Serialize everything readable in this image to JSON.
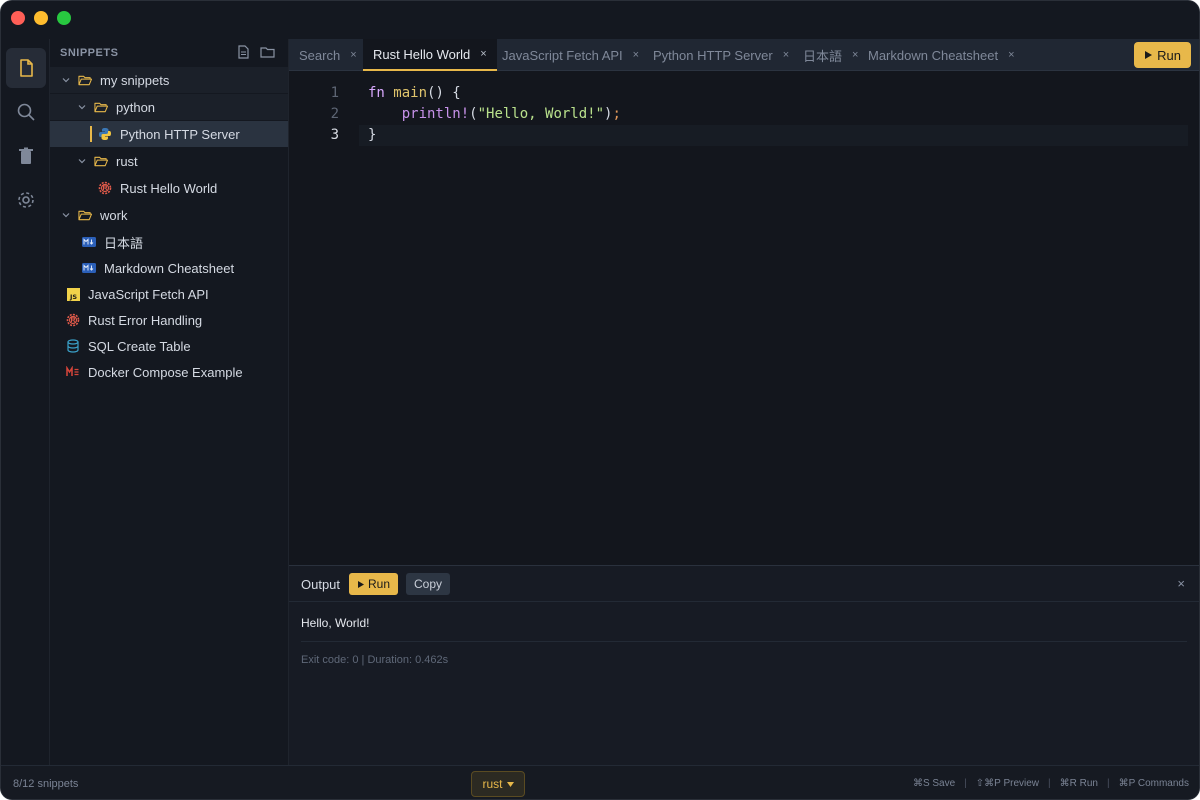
{
  "sidebar": {
    "title": "SNIPPETS",
    "tree": [
      {
        "label": "my snippets"
      },
      {
        "label": "python"
      },
      {
        "label": "Python HTTP Server"
      },
      {
        "label": "rust"
      },
      {
        "label": "Rust Hello World"
      },
      {
        "label": "work"
      },
      {
        "label": "日本語"
      },
      {
        "label": "Markdown Cheatsheet"
      },
      {
        "label": "JavaScript Fetch API"
      },
      {
        "label": "Rust Error Handling"
      },
      {
        "label": "SQL Create Table"
      },
      {
        "label": "Docker Compose Example"
      }
    ]
  },
  "tabs": [
    {
      "label": "Search"
    },
    {
      "label": "Rust Hello World"
    },
    {
      "label": "JavaScript Fetch API"
    },
    {
      "label": "Python HTTP Server"
    },
    {
      "label": "日本語"
    },
    {
      "label": "Markdown Cheatsheet"
    }
  ],
  "tab_close": "×",
  "toolbar": {
    "run_label": "Run"
  },
  "editor": {
    "line_numbers": [
      "1",
      "2",
      "3"
    ],
    "line1": {
      "kw": "fn",
      "fn": "main",
      "rest": "() {"
    },
    "line2": {
      "indent": "    ",
      "mac": "println!",
      "open": "(",
      "str": "\"Hello, World!\"",
      "close": ")",
      "semi": ";"
    },
    "line3": {
      "text": "}"
    }
  },
  "output": {
    "title": "Output",
    "run_label": "Run",
    "copy_label": "Copy",
    "close": "×",
    "text": "Hello, World!",
    "status": "Exit code: 0 | Duration: 0.462s"
  },
  "statusbar": {
    "count": "8/12 snippets",
    "language": "rust",
    "shortcuts": [
      "⌘S Save",
      "⇧⌘P Preview",
      "⌘R Run",
      "⌘P Commands"
    ],
    "separator": "|"
  },
  "colors": {
    "accent": "#e8b84a",
    "background": "#13161d",
    "sidebar": "#141820"
  }
}
